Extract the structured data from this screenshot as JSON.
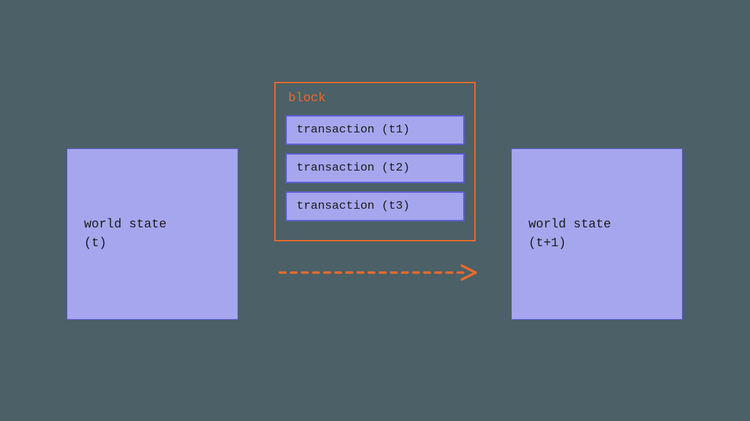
{
  "diagram": {
    "left_state": {
      "line1": "world state",
      "line2": "(t)"
    },
    "right_state": {
      "line1": "world state",
      "line2": "(t+1)"
    },
    "block": {
      "title": "block",
      "transactions": {
        "t0": "transaction (t1)",
        "t1": "transaction (t2)",
        "t2": "transaction (t3)"
      }
    },
    "colors": {
      "background": "#4b6067",
      "box_fill": "#a6a6ee",
      "box_border": "#5e5ed6",
      "accent": "#e96a2b"
    }
  }
}
